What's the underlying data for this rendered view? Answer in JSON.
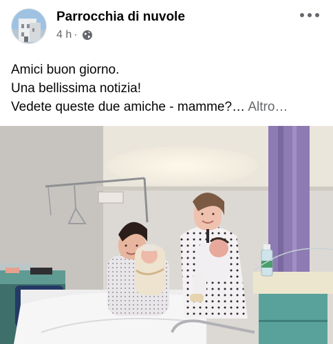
{
  "post": {
    "page_name": "Parrocchia di nuvole",
    "time": "4 h",
    "separator": "·",
    "icons": {
      "privacy": "globe-icon",
      "more": "more-options-icon",
      "avatar": "church-building-avatar"
    },
    "text_lines": [
      "Amici buon giorno.",
      "Una bellissima notizia!",
      "Vedete queste due amiche - mamme?…"
    ],
    "see_more": "Altro…",
    "photo": {
      "subject": "hospital-room-two-mothers-with-newborns"
    }
  }
}
